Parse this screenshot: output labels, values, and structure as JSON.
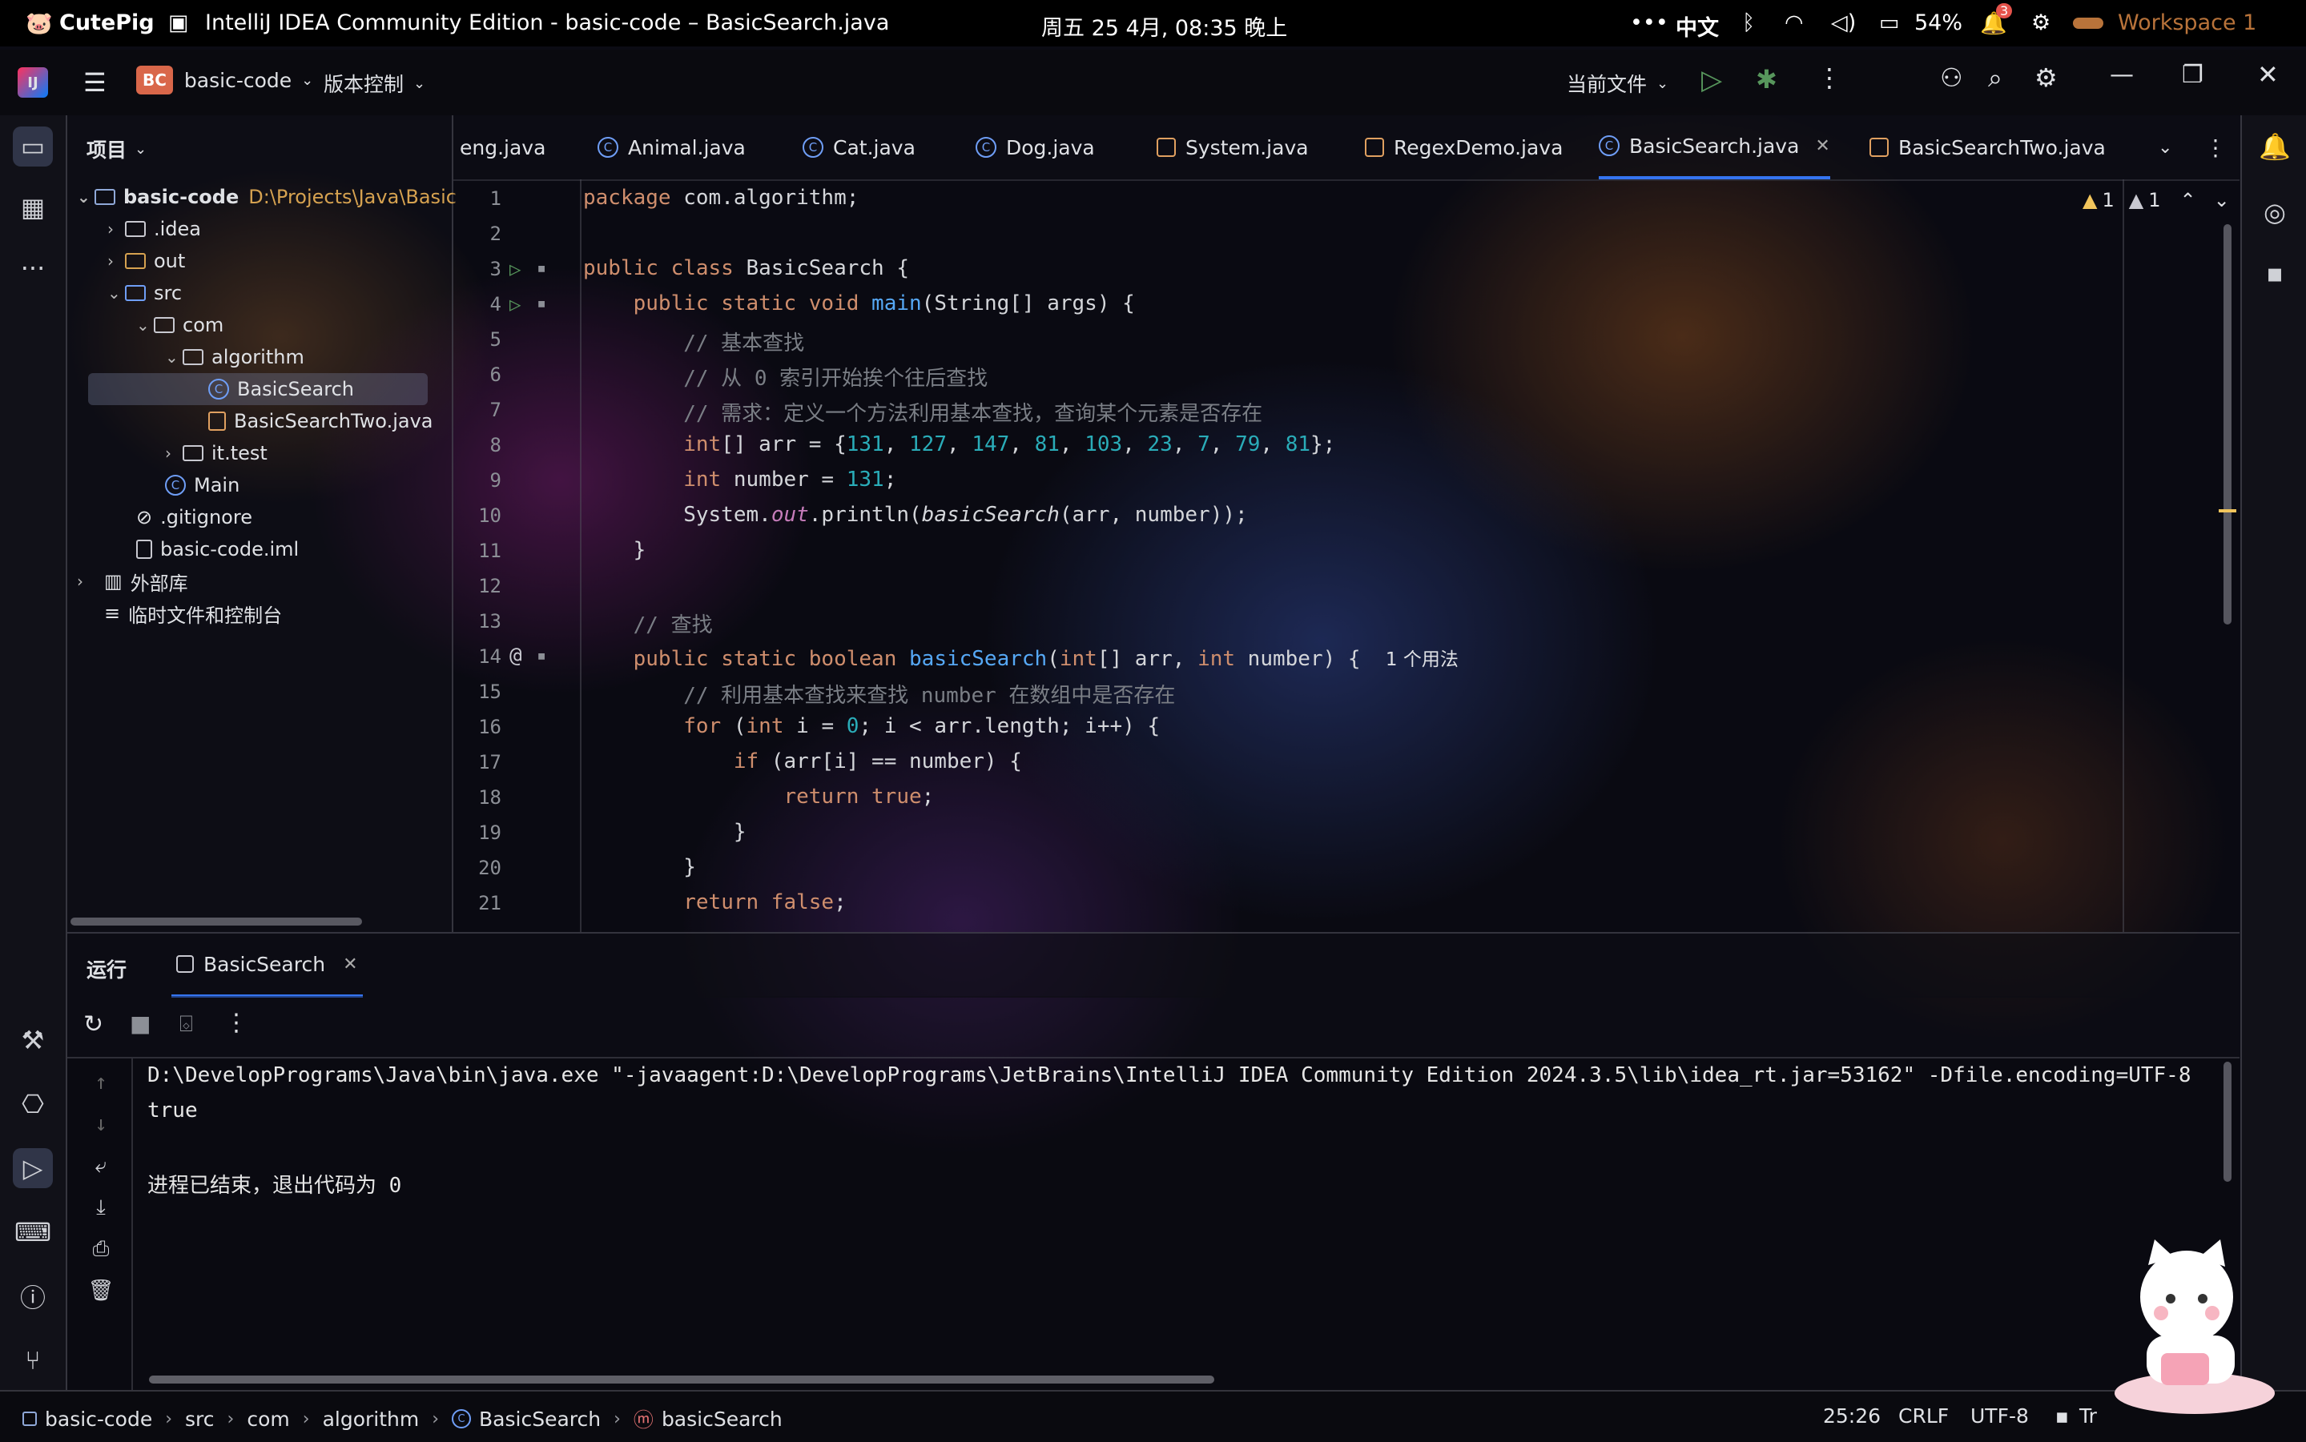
{
  "system_bar": {
    "app_name": "CutePig",
    "window_title": "IntelliJ IDEA Community Edition  -  basic-code – BasicSearch.java",
    "datetime": "周五 25 4月, 08:35 晚上",
    "input_method": "中文",
    "battery": "54%",
    "notifications_count": "3",
    "workspace": "Workspace 1"
  },
  "title_bar": {
    "project_badge": "BC",
    "project_name": "basic-code",
    "vcs_menu": "版本控制",
    "run_config": "当前文件"
  },
  "project_panel": {
    "header": "项目",
    "items": [
      {
        "label": "basic-code",
        "extra": "D:\\Projects\\Java\\Basic"
      },
      {
        "label": ".idea"
      },
      {
        "label": "out"
      },
      {
        "label": "src"
      },
      {
        "label": "com"
      },
      {
        "label": "algorithm"
      },
      {
        "label": "BasicSearch"
      },
      {
        "label": "BasicSearchTwo.java"
      },
      {
        "label": "it.test"
      },
      {
        "label": "Main"
      },
      {
        "label": ".gitignore"
      },
      {
        "label": "basic-code.iml"
      },
      {
        "label": "外部库"
      },
      {
        "label": "临时文件和控制台"
      }
    ]
  },
  "tabs": [
    {
      "label": "eng.java"
    },
    {
      "label": "Animal.java"
    },
    {
      "label": "Cat.java"
    },
    {
      "label": "Dog.java"
    },
    {
      "label": "System.java"
    },
    {
      "label": "RegexDemo.java"
    },
    {
      "label": "BasicSearch.java"
    },
    {
      "label": "BasicSearchTwo.java"
    }
  ],
  "editor": {
    "warnings": "1",
    "weak_warnings": "1",
    "line_numbers": [
      "1",
      "2",
      "3",
      "4",
      "5",
      "6",
      "7",
      "8",
      "9",
      "10",
      "11",
      "12",
      "13",
      "14",
      "15",
      "16",
      "17",
      "18",
      "19",
      "20",
      "21"
    ],
    "usage_hint": "1 个用法"
  },
  "run_panel": {
    "title": "运行",
    "tab": "BasicSearch",
    "output": [
      "D:\\DevelopPrograms\\Java\\bin\\java.exe \"-javaagent:D:\\DevelopPrograms\\JetBrains\\IntelliJ IDEA Community Edition 2024.3.5\\lib\\idea_rt.jar=53162\" -Dfile.encoding=UTF-8",
      "true",
      "",
      "进程已结束，退出代码为 0"
    ]
  },
  "status_bar": {
    "breadcrumbs": [
      "basic-code",
      "src",
      "com",
      "algorithm",
      "BasicSearch",
      "basicSearch"
    ],
    "position": "25:26",
    "line_ending": "CRLF",
    "encoding": "UTF-8",
    "extra": "Tr"
  }
}
